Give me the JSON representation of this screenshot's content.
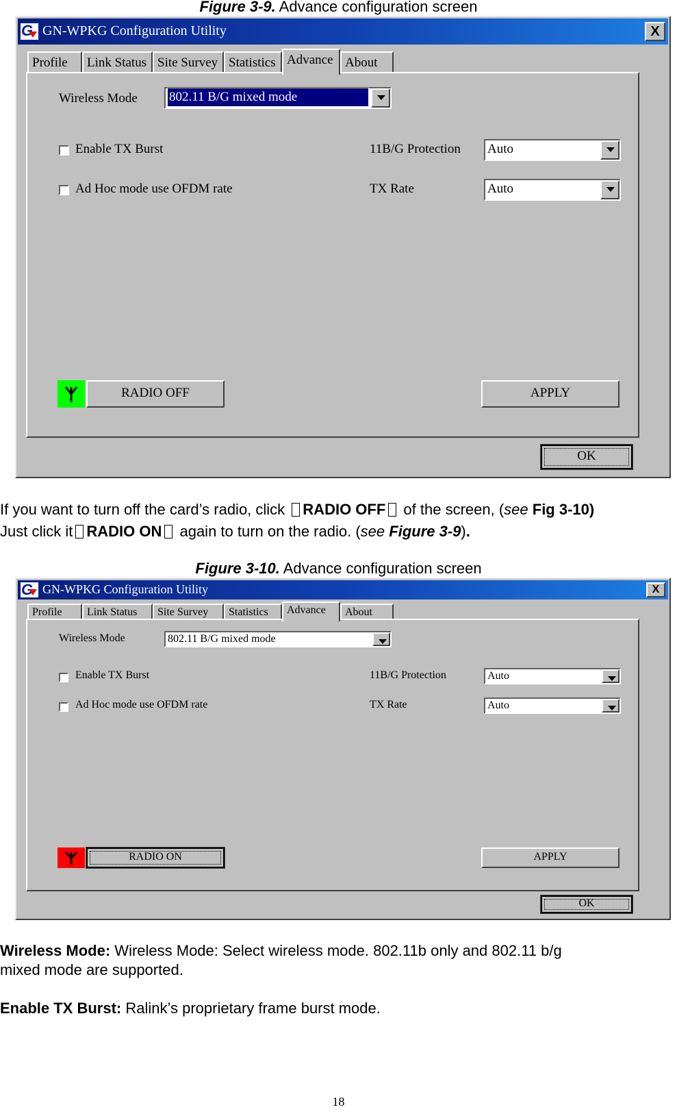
{
  "figures": [
    {
      "caption_label": "Figure 3-9.",
      "caption_text": " Advance configuration screen",
      "window": {
        "title": "GN-WPKG Configuration Utility",
        "close_label": "X",
        "tabs": [
          "Profile",
          "Link Status",
          "Site Survey",
          "Statistics",
          "Advance",
          "About"
        ],
        "active_tab": "Advance",
        "wireless_mode_label": "Wireless Mode",
        "wireless_mode_value": "802.11 B/G mixed mode",
        "enable_tx_burst_label": "Enable TX Burst",
        "enable_tx_burst_checked": false,
        "adhoc_ofdm_label": "Ad Hoc mode use OFDM rate",
        "adhoc_ofdm_checked": false,
        "protection_label": "11B/G Protection",
        "protection_value": "Auto",
        "tx_rate_label": "TX Rate",
        "tx_rate_value": "Auto",
        "radio_button_label": "RADIO OFF",
        "radio_indicator_color": "#00ff00",
        "apply_label": "APPLY",
        "ok_label": "OK"
      }
    },
    {
      "caption_label": "Figure 3-10.",
      "caption_text": " Advance configuration screen",
      "window": {
        "title": "GN-WPKG Configuration Utility",
        "close_label": "X",
        "tabs": [
          "Profile",
          "Link Status",
          "Site Survey",
          "Statistics",
          "Advance",
          "About"
        ],
        "active_tab": "Advance",
        "wireless_mode_label": "Wireless Mode",
        "wireless_mode_value": "802.11 B/G mixed mode",
        "enable_tx_burst_label": "Enable TX Burst",
        "enable_tx_burst_checked": false,
        "adhoc_ofdm_label": "Ad Hoc mode use OFDM rate",
        "adhoc_ofdm_checked": false,
        "protection_label": "11B/G Protection",
        "protection_value": "Auto",
        "tx_rate_label": "TX Rate",
        "tx_rate_value": "Auto",
        "radio_button_label": "RADIO ON",
        "radio_indicator_color": "#ff0000",
        "apply_label": "APPLY",
        "ok_label": "OK"
      }
    }
  ],
  "text": {
    "para1_line1": {
      "a": "If you want to turn off the card’s radio, click ",
      "b": "RADIO OFF",
      "c": " of the screen, (",
      "d": "see",
      "e": " Fig 3-10)"
    },
    "para1_line2": {
      "a": "Just click it",
      "b": "RADIO ON",
      "c": "   again to turn on the radio. (",
      "d": "see",
      "e": " ",
      "f": "Figure 3-9",
      "g": ")",
      "h": "."
    },
    "wireless_mode_term": "Wireless Mode:",
    "wireless_mode_desc_1": " Wireless Mode: Select wireless mode. 802.11b only and 802.11 b/g",
    "wireless_mode_desc_2": "mixed mode are supported.",
    "tx_burst_term": "Enable TX Burst:",
    "tx_burst_desc": " Ralink’s proprietary frame burst mode."
  },
  "page_number": "18"
}
